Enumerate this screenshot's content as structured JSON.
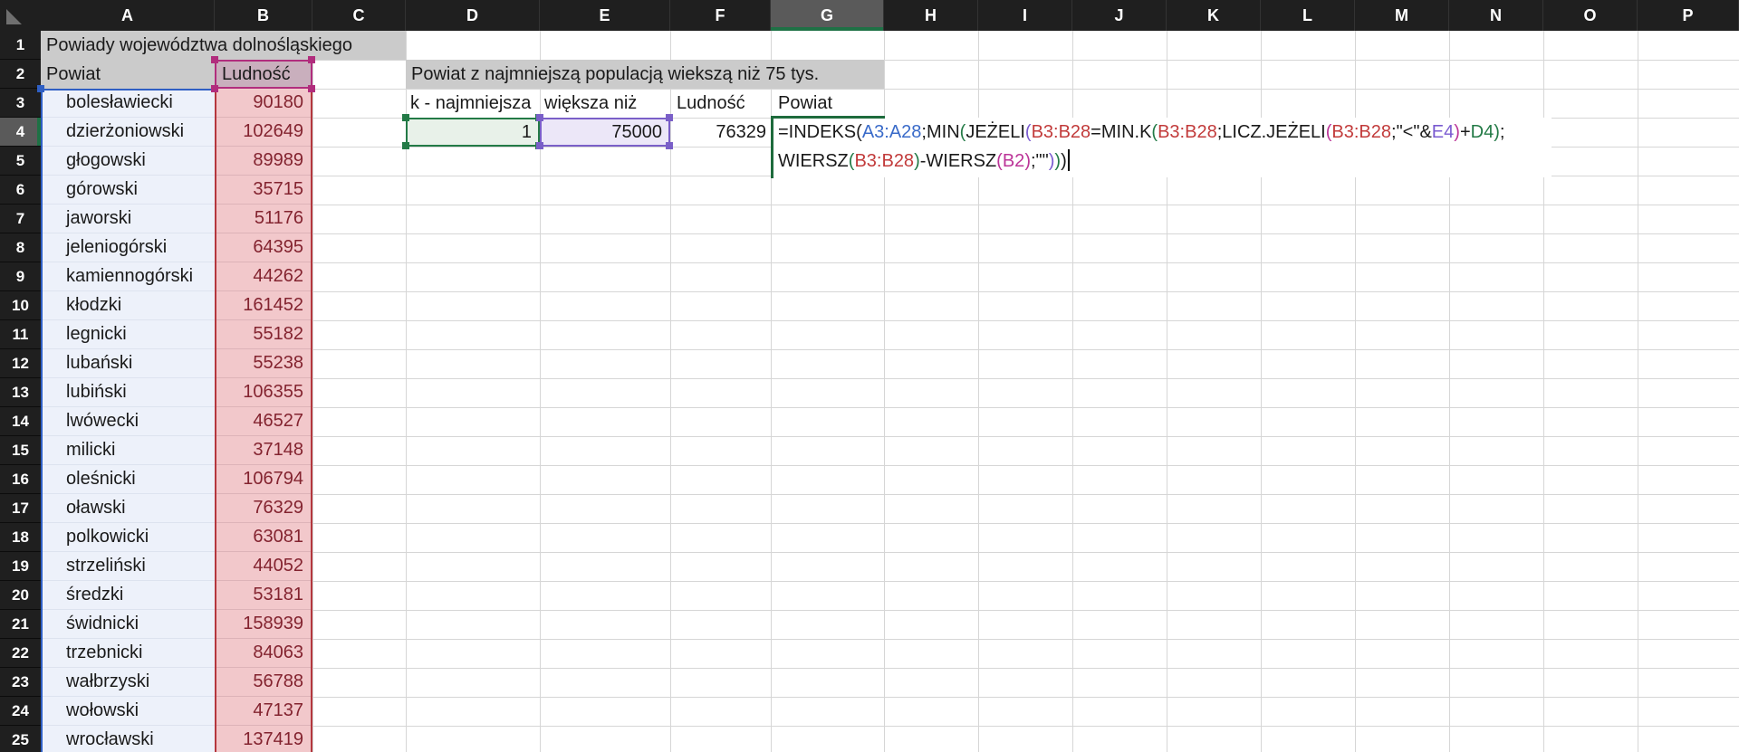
{
  "sheet": {
    "columns": [
      "A",
      "B",
      "C",
      "D",
      "E",
      "F",
      "G",
      "H",
      "I",
      "J",
      "K",
      "L",
      "M",
      "N",
      "O",
      "P"
    ],
    "row_numbers": [
      1,
      2,
      3,
      4,
      5,
      6,
      7,
      8,
      9,
      10,
      11,
      12,
      13,
      14,
      15,
      16,
      17,
      18,
      19,
      20,
      21,
      22,
      23,
      24,
      25
    ],
    "active_column": "G",
    "active_row": 4
  },
  "cells": {
    "a1_title": "Powiady województwa dolnośląskiego",
    "a2_header": "Powiat",
    "b2_header": "Ludność",
    "d2_title": "Powiat z najmniejszą populacją wiekszą niż 75 tys.",
    "d3_label": "k - najmniejsza",
    "e3_label": "większa niż",
    "f3_label": "Ludność",
    "g3_label": "Powiat",
    "d4_value": "1",
    "e4_value": "75000",
    "f4_value": "76329"
  },
  "table": {
    "rows": [
      {
        "powiat": "bolesławiecki",
        "ludnosc": "90180"
      },
      {
        "powiat": "dzierżoniowski",
        "ludnosc": "102649"
      },
      {
        "powiat": "głogowski",
        "ludnosc": "89989"
      },
      {
        "powiat": "górowski",
        "ludnosc": "35715"
      },
      {
        "powiat": "jaworski",
        "ludnosc": "51176"
      },
      {
        "powiat": "jeleniogórski",
        "ludnosc": "64395"
      },
      {
        "powiat": "kamiennogórski",
        "ludnosc": "44262"
      },
      {
        "powiat": "kłodzki",
        "ludnosc": "161452"
      },
      {
        "powiat": "legnicki",
        "ludnosc": "55182"
      },
      {
        "powiat": "lubański",
        "ludnosc": "55238"
      },
      {
        "powiat": "lubiński",
        "ludnosc": "106355"
      },
      {
        "powiat": "lwówecki",
        "ludnosc": "46527"
      },
      {
        "powiat": "milicki",
        "ludnosc": "37148"
      },
      {
        "powiat": "oleśnicki",
        "ludnosc": "106794"
      },
      {
        "powiat": "oławski",
        "ludnosc": "76329"
      },
      {
        "powiat": "polkowicki",
        "ludnosc": "63081"
      },
      {
        "powiat": "strzeliński",
        "ludnosc": "44052"
      },
      {
        "powiat": "średzki",
        "ludnosc": "53181"
      },
      {
        "powiat": "świdnicki",
        "ludnosc": "158939"
      },
      {
        "powiat": "trzebnicki",
        "ludnosc": "84063"
      },
      {
        "powiat": "wałbrzyski",
        "ludnosc": "56788"
      },
      {
        "powiat": "wołowski",
        "ludnosc": "47137"
      },
      {
        "powiat": "wrocławski",
        "ludnosc": "137419"
      }
    ]
  },
  "formula": {
    "cell": "G4",
    "line1": [
      [
        "=INDEKS(",
        "black"
      ],
      [
        "A3:A28",
        "blue"
      ],
      [
        ";MIN",
        "black"
      ],
      [
        "(",
        "green"
      ],
      [
        "JEŻELI",
        "black"
      ],
      [
        "(",
        "purple"
      ],
      [
        "B3:B28",
        "red"
      ],
      [
        "=MIN.K",
        "black"
      ],
      [
        "(",
        "green"
      ],
      [
        "B3:B28",
        "red"
      ],
      [
        ";LICZ.JEŻELI",
        "black"
      ],
      [
        "(",
        "magenta"
      ],
      [
        "B3:B28",
        "red"
      ],
      [
        ";\"<\"&",
        "black"
      ],
      [
        "E4",
        "purple"
      ],
      [
        ")",
        "magenta"
      ],
      [
        "+",
        "black"
      ],
      [
        "D4",
        "green"
      ],
      [
        ")",
        "green"
      ],
      [
        ";",
        "black"
      ]
    ],
    "line2": [
      [
        "WIERSZ",
        "black"
      ],
      [
        "(",
        "green"
      ],
      [
        "B3:B28",
        "red"
      ],
      [
        ")",
        "green"
      ],
      [
        "-WIERSZ",
        "black"
      ],
      [
        "(",
        "magenta"
      ],
      [
        "B2",
        "magenta"
      ],
      [
        ")",
        "magenta"
      ],
      [
        ";\"\"",
        "black"
      ],
      [
        ")",
        "purple"
      ],
      [
        ")",
        "green"
      ],
      [
        ")",
        "black"
      ]
    ]
  },
  "colors": {
    "ref_blue": "#3a6bc9",
    "ref_red": "#c23b3b",
    "ref_green": "#237a46",
    "ref_purple": "#7a5bd0",
    "ref_magenta": "#bc3498",
    "accent_green": "#1e7145",
    "header_bg": "#1f1f1f",
    "header_active_bg": "#5a5a5a",
    "title_gray": "#cbcbcb",
    "a_range_fill": "#edf1fa",
    "b_range_fill": "#f2c8cb",
    "b_value_text": "#83232f"
  }
}
